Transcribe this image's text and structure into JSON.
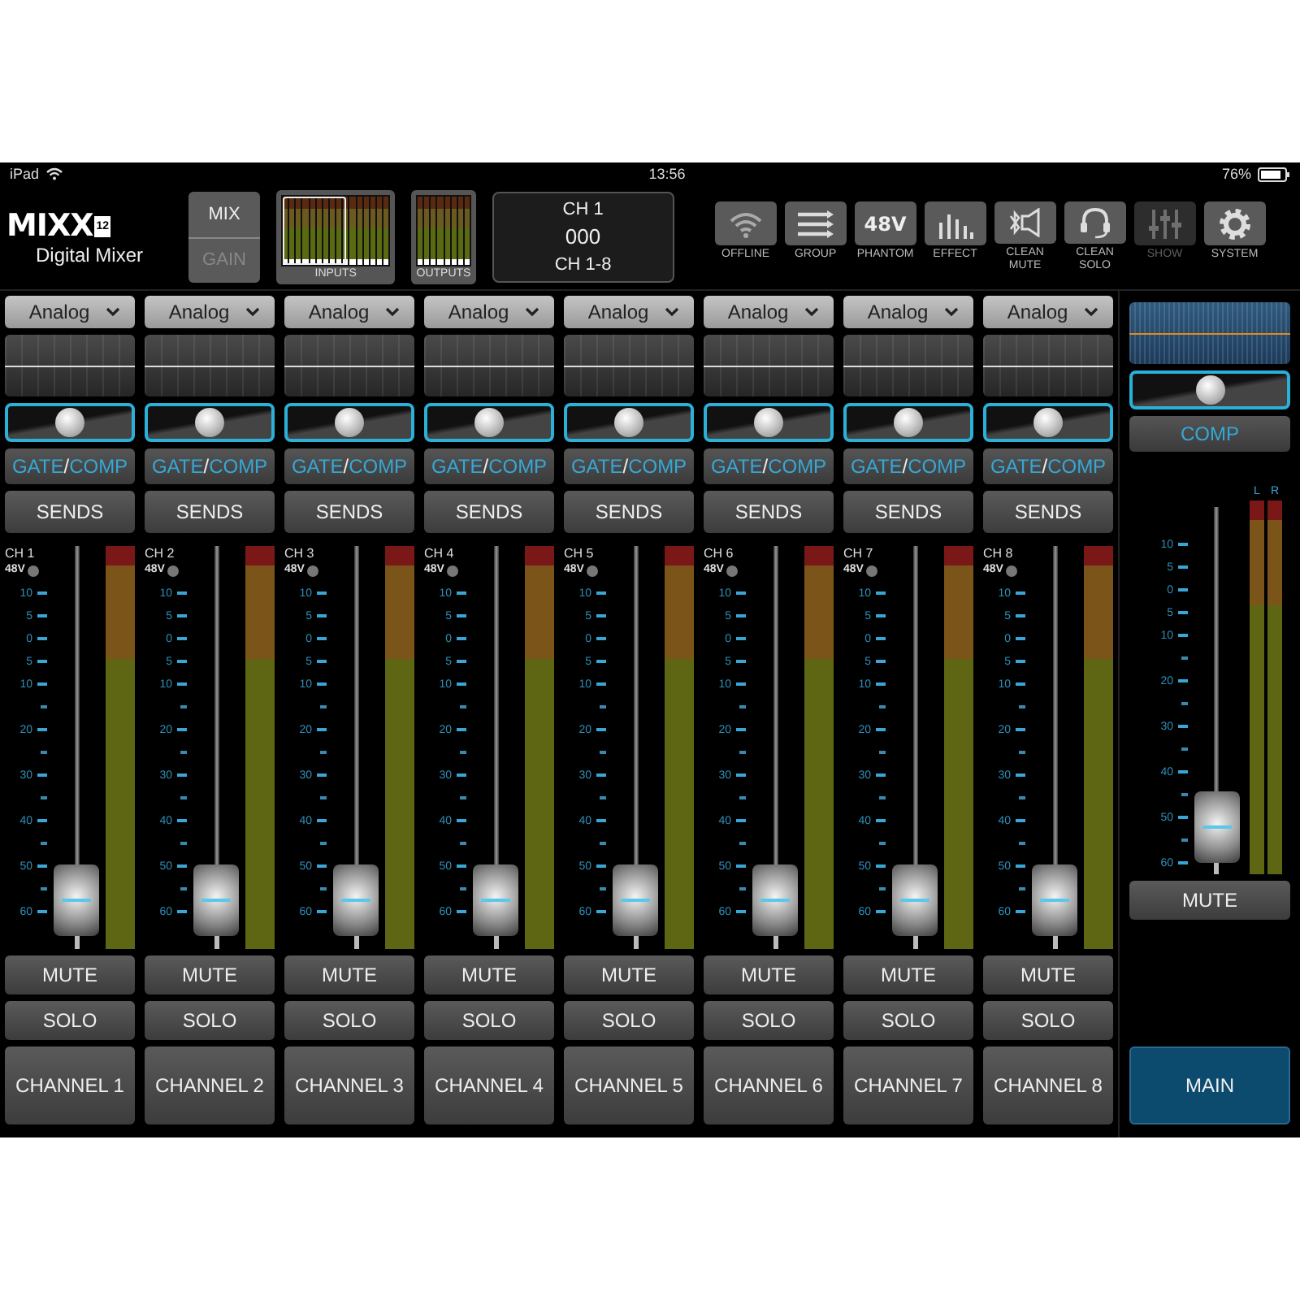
{
  "status_bar": {
    "device": "iPad",
    "time": "13:56",
    "battery": "76%"
  },
  "header": {
    "logo": {
      "wordmark": "MIXX",
      "badge": "12",
      "subtitle": "Digital Mixer"
    },
    "mode_switch": [
      {
        "label": "MIX",
        "selected": true
      },
      {
        "label": "GAIN",
        "selected": false
      }
    ],
    "meter_buttons": [
      {
        "label": "INPUTS"
      },
      {
        "label": "OUTPUTS"
      }
    ],
    "display": {
      "channel": "CH 1",
      "value": "000",
      "bank": "CH 1-8"
    },
    "toolbar": [
      {
        "kind": "wifi",
        "label": "OFFLINE",
        "disabled": false
      },
      {
        "kind": "group",
        "label": "GROUP",
        "disabled": false
      },
      {
        "kind": "phantom",
        "label": "PHANTOM",
        "icon_text": "48V",
        "disabled": false
      },
      {
        "kind": "effect",
        "label": "EFFECT",
        "disabled": false
      },
      {
        "kind": "mute",
        "label": "CLEAN MUTE",
        "disabled": false
      },
      {
        "kind": "solo",
        "label": "CLEAN SOLO",
        "disabled": false
      },
      {
        "kind": "show",
        "label": "SHOW",
        "disabled": true
      },
      {
        "kind": "system",
        "label": "SYSTEM",
        "disabled": false
      }
    ]
  },
  "channels": [
    {
      "source": "Analog",
      "dynamics": {
        "gate": "GATE",
        "sep": "/",
        "comp": "COMP"
      },
      "sends": "SENDS",
      "label": "CH 1",
      "phantom": "48V",
      "phantom_on": false,
      "scale": [
        "10",
        "5",
        "0",
        "5",
        "10",
        "20",
        "30",
        "40",
        "50",
        "60"
      ],
      "fader": {
        "level": 0.04
      },
      "mute": "MUTE",
      "solo": "SOLO",
      "name": "CHANNEL 1",
      "selected": false
    },
    {
      "source": "Analog",
      "dynamics": {
        "gate": "GATE",
        "sep": "/",
        "comp": "COMP"
      },
      "sends": "SENDS",
      "label": "CH 2",
      "phantom": "48V",
      "phantom_on": false,
      "scale": [
        "10",
        "5",
        "0",
        "5",
        "10",
        "20",
        "30",
        "40",
        "50",
        "60"
      ],
      "fader": {
        "level": 0.04
      },
      "mute": "MUTE",
      "solo": "SOLO",
      "name": "CHANNEL 2",
      "selected": false
    },
    {
      "source": "Analog",
      "dynamics": {
        "gate": "GATE",
        "sep": "/",
        "comp": "COMP"
      },
      "sends": "SENDS",
      "label": "CH 3",
      "phantom": "48V",
      "phantom_on": false,
      "scale": [
        "10",
        "5",
        "0",
        "5",
        "10",
        "20",
        "30",
        "40",
        "50",
        "60"
      ],
      "fader": {
        "level": 0.04
      },
      "mute": "MUTE",
      "solo": "SOLO",
      "name": "CHANNEL 3",
      "selected": false
    },
    {
      "source": "Analog",
      "dynamics": {
        "gate": "GATE",
        "sep": "/",
        "comp": "COMP"
      },
      "sends": "SENDS",
      "label": "CH 4",
      "phantom": "48V",
      "phantom_on": false,
      "scale": [
        "10",
        "5",
        "0",
        "5",
        "10",
        "20",
        "30",
        "40",
        "50",
        "60"
      ],
      "fader": {
        "level": 0.04
      },
      "mute": "MUTE",
      "solo": "SOLO",
      "name": "CHANNEL 4",
      "selected": false
    },
    {
      "source": "Analog",
      "dynamics": {
        "gate": "GATE",
        "sep": "/",
        "comp": "COMP"
      },
      "sends": "SENDS",
      "label": "CH 5",
      "phantom": "48V",
      "phantom_on": false,
      "scale": [
        "10",
        "5",
        "0",
        "5",
        "10",
        "20",
        "30",
        "40",
        "50",
        "60"
      ],
      "fader": {
        "level": 0.04
      },
      "mute": "MUTE",
      "solo": "SOLO",
      "name": "CHANNEL 5",
      "selected": false
    },
    {
      "source": "Analog",
      "dynamics": {
        "gate": "GATE",
        "sep": "/",
        "comp": "COMP"
      },
      "sends": "SENDS",
      "label": "CH 6",
      "phantom": "48V",
      "phantom_on": false,
      "scale": [
        "10",
        "5",
        "0",
        "5",
        "10",
        "20",
        "30",
        "40",
        "50",
        "60"
      ],
      "fader": {
        "level": 0.04
      },
      "mute": "MUTE",
      "solo": "SOLO",
      "name": "CHANNEL 6",
      "selected": false
    },
    {
      "source": "Analog",
      "dynamics": {
        "gate": "GATE",
        "sep": "/",
        "comp": "COMP"
      },
      "sends": "SENDS",
      "label": "CH 7",
      "phantom": "48V",
      "phantom_on": false,
      "scale": [
        "10",
        "5",
        "0",
        "5",
        "10",
        "20",
        "30",
        "40",
        "50",
        "60"
      ],
      "fader": {
        "level": 0.04
      },
      "mute": "MUTE",
      "solo": "SOLO",
      "name": "CHANNEL 7",
      "selected": false
    },
    {
      "source": "Analog",
      "dynamics": {
        "gate": "GATE",
        "sep": "/",
        "comp": "COMP"
      },
      "sends": "SENDS",
      "label": "CH 8",
      "phantom": "48V",
      "phantom_on": false,
      "scale": [
        "10",
        "5",
        "0",
        "5",
        "10",
        "20",
        "30",
        "40",
        "50",
        "60"
      ],
      "fader": {
        "level": 0.04
      },
      "mute": "MUTE",
      "solo": "SOLO",
      "name": "CHANNEL 8",
      "selected": false
    }
  ],
  "master": {
    "dynamics": "COMP",
    "meter_labels": [
      "L",
      "R"
    ],
    "scale": [
      "10",
      "5",
      "0",
      "5",
      "10",
      "20",
      "30",
      "40",
      "50",
      "60"
    ],
    "fader": {
      "level": 0.04
    },
    "mute": "MUTE",
    "name": "MAIN",
    "selected": true
  }
}
